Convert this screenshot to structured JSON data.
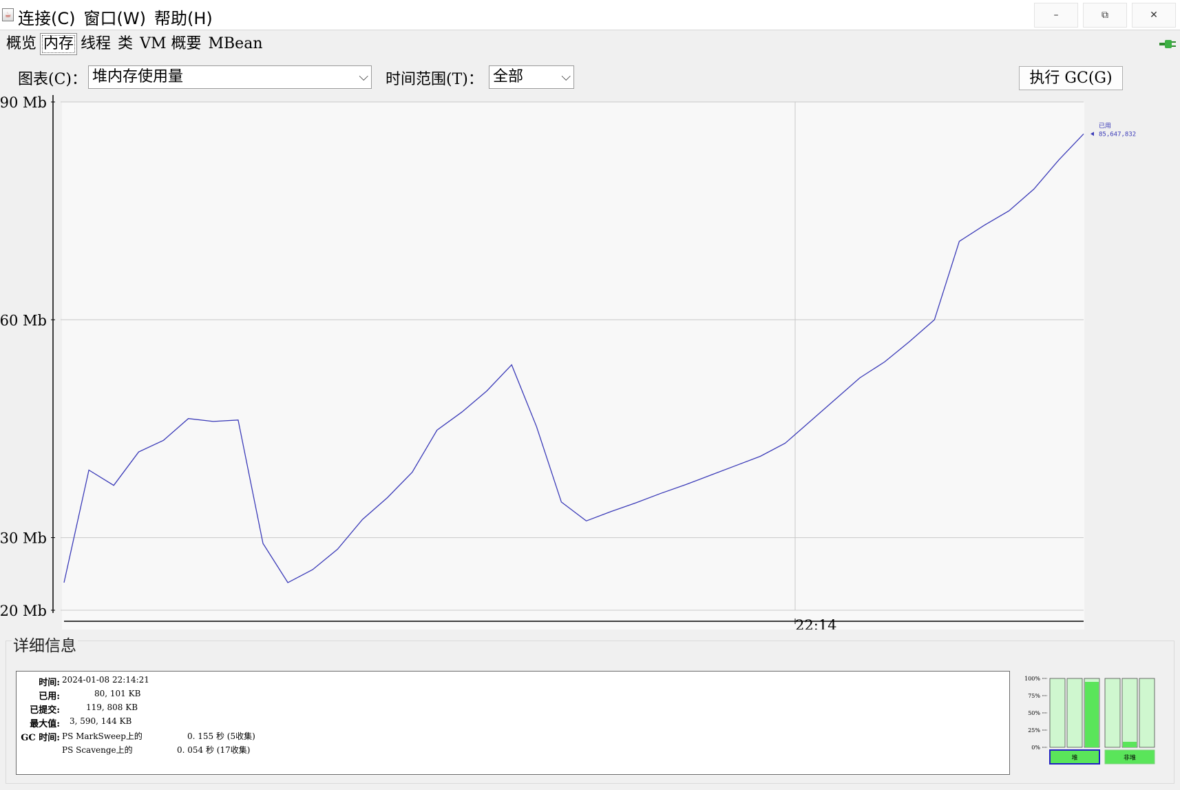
{
  "window": {
    "menu": [
      "连接(C)",
      "窗口(W)",
      "帮助(H)"
    ],
    "controls": {
      "minimize": "–",
      "maximize": "⧉",
      "close": "✕"
    }
  },
  "tabs": [
    {
      "label": "概览",
      "active": false
    },
    {
      "label": "内存",
      "active": true
    },
    {
      "label": "线程",
      "active": false
    },
    {
      "label": "类",
      "active": false
    },
    {
      "label": "VM 概要",
      "active": false
    },
    {
      "label": "MBean",
      "active": false
    }
  ],
  "toolbar": {
    "chart_label": "图表(C)：",
    "chart_value": "堆内存使用量",
    "range_label": "时间范围(T)：",
    "range_value": "全部",
    "gc_button": "执行 GC(G)"
  },
  "chart_data": {
    "type": "line",
    "y_ticks": [
      {
        "value": 90,
        "label": "90 Mb"
      },
      {
        "value": 60,
        "label": "60 Mb"
      },
      {
        "value": 30,
        "label": "30 Mb"
      },
      {
        "value": 20,
        "label": "20 Mb"
      }
    ],
    "ylim": [
      20,
      90
    ],
    "x_tick_label": "22:14",
    "x_tick_index": 29.4,
    "x_count": 42,
    "grid": true,
    "series": [
      {
        "name": "已用",
        "color": "#3a3ab8",
        "last_value_label": "85,647,832",
        "values": [
          23.8,
          39.3,
          37.2,
          41.8,
          43.4,
          46.4,
          46.0,
          46.2,
          29.2,
          23.8,
          25.6,
          28.4,
          32.5,
          35.5,
          39.0,
          44.8,
          47.3,
          50.2,
          53.8,
          45.3,
          34.9,
          32.3,
          33.6,
          34.8,
          36.1,
          37.3,
          38.6,
          39.9,
          41.2,
          43.0,
          46.0,
          49.0,
          52.0,
          54.2,
          57.0,
          60.0,
          70.8,
          73.0,
          75.0,
          78.0,
          82.0,
          85.6
        ]
      }
    ]
  },
  "details": {
    "title": "详细信息",
    "time_label": "时间:",
    "time_value": "2024-01-08 22:14:21",
    "used_label": "已用:",
    "used_value": "80, 101 KB",
    "committed_label": "已提交:",
    "committed_value": "119, 808 KB",
    "max_label": "最大值:",
    "max_value": "3, 590, 144 KB",
    "gc_label": "GC 时间:",
    "gc_rows": [
      {
        "name": "PS MarkSweep上的",
        "value": "0. 155 秒 (5收集)"
      },
      {
        "name": "PS Scavenge上的",
        "value": "0. 054 秒 (17收集)"
      }
    ]
  },
  "pools": {
    "ticks": [
      "100%",
      "75%",
      "50%",
      "25%",
      "0%"
    ],
    "heap_label": "堆",
    "nonheap_label": "非堆",
    "heap_bars": [
      0.0,
      0.0,
      0.95
    ],
    "nonheap_bars": [
      0.0,
      0.08,
      0.0
    ],
    "colors": {
      "bar_bg": "#cff7cf",
      "bar_fill": "#5ae55a",
      "border": "#4a4a4a",
      "heap_box": "#5ae55a",
      "heap_border": "#2020c0"
    }
  }
}
